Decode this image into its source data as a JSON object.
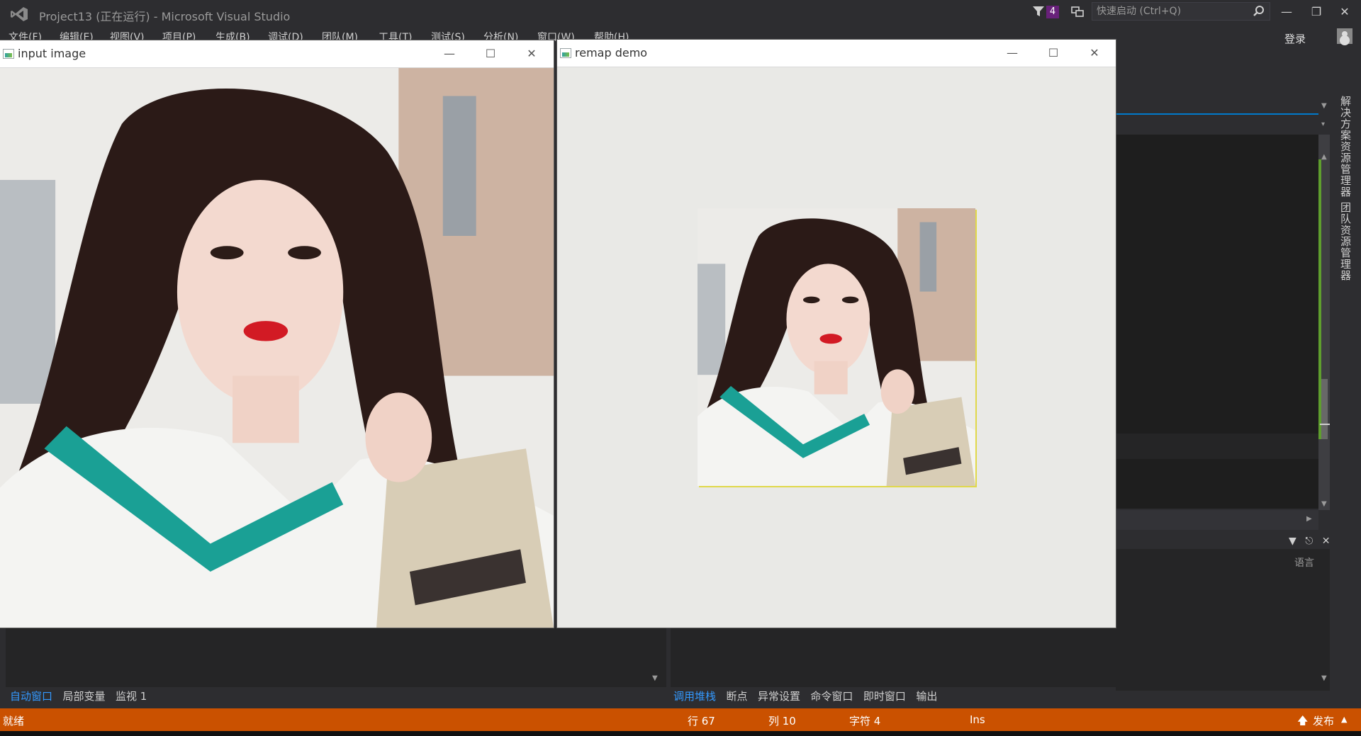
{
  "titlebar": {
    "title": "Project13 (正在运行) - Microsoft Visual Studio",
    "notification_count": "4",
    "quick_launch_placeholder": "快速启动 (Ctrl+Q)"
  },
  "menu": [
    "文件(F)",
    "编辑(E)",
    "视图(V)",
    "项目(P)",
    "生成(B)",
    "调试(D)",
    "团队(M)",
    "工具(T)",
    "测试(S)",
    "分析(N)",
    "窗口(W)",
    "帮助(H)"
  ],
  "account": {
    "login_label": "登录"
  },
  "side_tabs": [
    "解决方案资源管理器",
    "团队资源管理器"
  ],
  "right_panel": {
    "lang_label": "语言"
  },
  "windows": {
    "input": {
      "title": "input image"
    },
    "remap": {
      "title": "remap demo"
    }
  },
  "bottom_left_tabs": [
    "自动窗口",
    "局部变量",
    "监视 1"
  ],
  "bottom_right_tabs": [
    "调用堆栈",
    "断点",
    "异常设置",
    "命令窗口",
    "即时窗口",
    "输出"
  ],
  "statusbar": {
    "ready": "就绪",
    "line": "行 67",
    "col": "列 10",
    "char": "字符 4",
    "mode": "Ins",
    "publish": "发布"
  },
  "colors": {
    "vs_background": "#2d2d30",
    "status_bar": "#ca5100",
    "accent_blue": "#007acc",
    "badge_purple": "#68217a"
  }
}
